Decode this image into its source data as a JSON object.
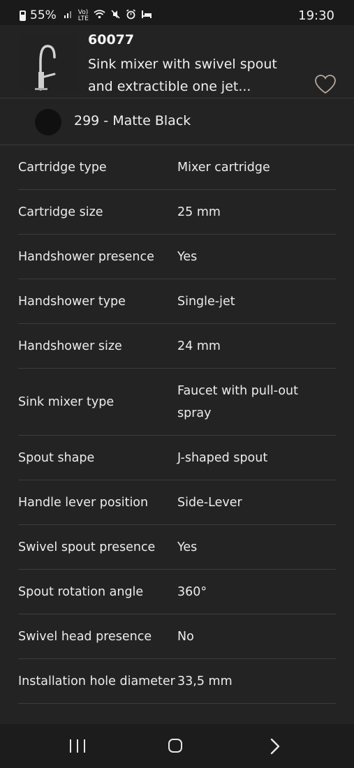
{
  "status_bar": {
    "battery": "55%",
    "time": "19:30",
    "icons": [
      "signal-icon",
      "volte-icon",
      "wifi-icon",
      "mute-icon",
      "alarm-icon",
      "sleep-icon"
    ]
  },
  "product": {
    "code": "60077",
    "name": "Sink mixer with swivel spout and extractible one jet...",
    "favorite_icon": "heart-outline-icon"
  },
  "finish": {
    "label": "299 - Matte Black",
    "swatch_color": "#101010"
  },
  "specs": [
    {
      "label": "Cartridge type",
      "value": "Mixer cartridge"
    },
    {
      "label": "Cartridge size",
      "value": "25 mm"
    },
    {
      "label": "Handshower presence",
      "value": "Yes"
    },
    {
      "label": "Handshower type",
      "value": "Single-jet"
    },
    {
      "label": "Handshower size",
      "value": "24 mm"
    },
    {
      "label": "Sink mixer type",
      "value": "Faucet with pull-out spray"
    },
    {
      "label": "Spout shape",
      "value": "J-shaped spout"
    },
    {
      "label": "Handle lever position",
      "value": "Side-Lever"
    },
    {
      "label": "Swivel spout presence",
      "value": "Yes"
    },
    {
      "label": "Spout rotation angle",
      "value": "360°"
    },
    {
      "label": "Swivel head presence",
      "value": "No"
    },
    {
      "label": "Installation hole diameter",
      "value": "33,5 mm"
    }
  ],
  "nav": {
    "recents_icon": "recents-icon",
    "home_icon": "home-icon",
    "back_icon": "back-chevron-icon"
  },
  "colors": {
    "background": "#232323",
    "divider": "#3c3c3c",
    "text": "#ececec",
    "heart": "#b8a89a"
  }
}
